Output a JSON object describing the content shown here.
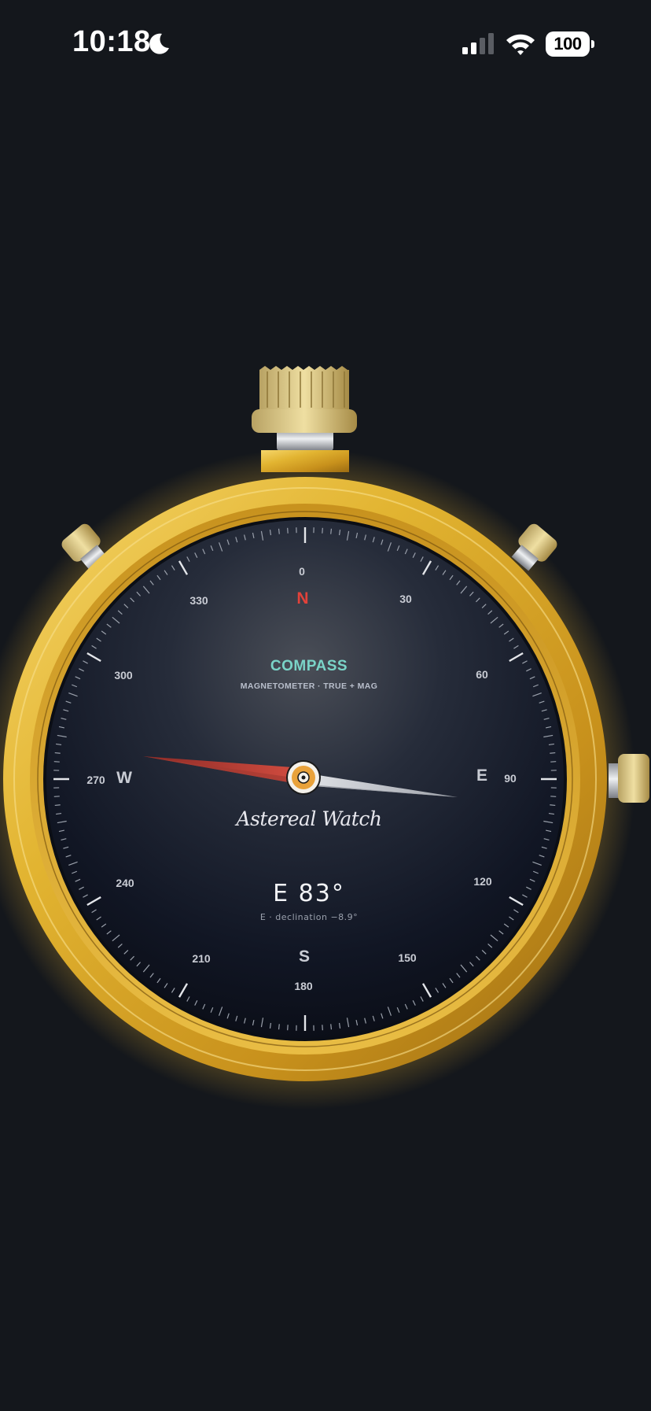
{
  "status_bar": {
    "time": "10:18",
    "focus_icon": "moon-icon",
    "signal_icon": "cellular-signal-icon",
    "wifi_icon": "wifi-icon",
    "battery_level": "100"
  },
  "compass": {
    "title": "COMPASS",
    "subtitle": "MAGNETOMETER · TRUE + MAG",
    "brand": "Astereal Watch",
    "heading_readout": "E 83°",
    "declination_text": "E · declination −8.9°",
    "heading_degrees": 83,
    "cardinals": {
      "north": "N",
      "east": "E",
      "south": "S",
      "west": "W"
    },
    "degree_labels": [
      "0",
      "30",
      "60",
      "90",
      "120",
      "150",
      "180",
      "210",
      "240",
      "270",
      "300",
      "330"
    ],
    "colors": {
      "accent_title": "#7ad4c8",
      "north_marker": "#e2423a",
      "gold_case": "#d9a928",
      "needle_north": "#c8443a",
      "needle_south": "#c9ccd2"
    }
  }
}
